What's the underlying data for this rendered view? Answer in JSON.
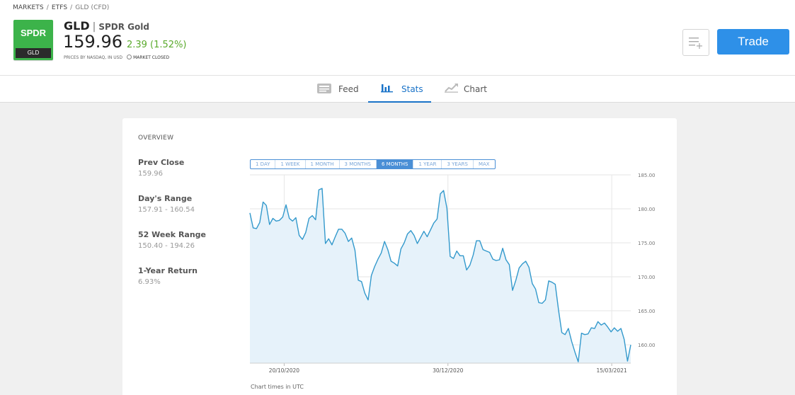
{
  "breadcrumb": {
    "items": [
      "MARKETS",
      "ETFS"
    ],
    "current": "GLD (CFD)"
  },
  "logo": {
    "top": "SPDR",
    "bottom": "GLD"
  },
  "instrument": {
    "symbol": "GLD",
    "name": "SPDR Gold",
    "price": "159.96",
    "change": "2.39 (1.52%)",
    "price_source": "PRICES BY NASDAQ, IN USD",
    "market_status": "MARKET CLOSED"
  },
  "colors": {
    "accent": "#2e90e8",
    "positive": "#5aaa2c",
    "brand_logo": "#3cb34a",
    "line": "#3399cc",
    "area": "#e6f2fa"
  },
  "icons": {
    "watchlist": "list-add-icon",
    "feed": "feed-icon",
    "stats": "bar-chart-icon",
    "chart": "line-chart-icon",
    "clock": "clock-icon"
  },
  "actions": {
    "trade_label": "Trade"
  },
  "tabs": [
    {
      "label": "Feed",
      "active": false
    },
    {
      "label": "Stats",
      "active": true
    },
    {
      "label": "Chart",
      "active": false
    }
  ],
  "overview": {
    "title": "OVERVIEW",
    "stats": [
      {
        "label": "Prev Close",
        "value": "159.96"
      },
      {
        "label": "Day's Range",
        "value": "157.91 - 160.54"
      },
      {
        "label": "52 Week Range",
        "value": "150.40 - 194.26"
      },
      {
        "label": "1-Year Return",
        "value": "6.93%"
      }
    ],
    "ranges": [
      "1 DAY",
      "1 WEEK",
      "1 MONTH",
      "3 MONTHS",
      "6 MONTHS",
      "1 YEAR",
      "3 YEARS",
      "MAX"
    ],
    "active_range": "6 MONTHS",
    "chart_note": "Chart times in UTC"
  },
  "chart_data": {
    "type": "area",
    "ylim": [
      157.3,
      185.0
    ],
    "y_ticks": [
      "185.00",
      "180.00",
      "175.00",
      "170.00",
      "165.00",
      "160.00"
    ],
    "y_tick_values": [
      185,
      180,
      175,
      170,
      165,
      160
    ],
    "x_tick_labels": [
      "20/10/2020",
      "30/12/2020",
      "15/03/2021"
    ],
    "x_tick_positions": [
      9,
      52,
      95
    ],
    "grid": true,
    "series": [
      {
        "values": [
          179.4,
          177.2,
          177.1,
          178.0,
          181.0,
          180.5,
          177.7,
          178.6,
          178.2,
          178.3,
          178.8,
          180.6,
          178.6,
          178.2,
          178.7,
          176.1,
          175.5,
          176.5,
          178.6,
          179.0,
          178.4,
          182.8,
          183.0,
          174.9,
          175.6,
          174.7,
          175.9,
          177.0,
          177.0,
          176.4,
          175.2,
          175.7,
          173.9,
          169.5,
          169.3,
          167.6,
          166.6,
          170.2,
          171.5,
          172.6,
          173.5,
          175.2,
          174.0,
          172.3,
          172.0,
          171.6,
          174.1,
          175.0,
          176.3,
          176.8,
          176.1,
          174.9,
          175.8,
          176.7,
          175.9,
          176.9,
          177.9,
          178.5,
          182.2,
          182.7,
          180.1,
          173.0,
          172.7,
          173.8,
          173.1,
          173.1,
          171.0,
          171.7,
          173.2,
          175.3,
          175.3,
          174.0,
          173.8,
          173.6,
          172.6,
          172.4,
          172.5,
          174.2,
          172.5,
          171.8,
          168.0,
          169.5,
          171.3,
          171.9,
          172.3,
          171.4,
          169.0,
          168.2,
          166.2,
          166.1,
          166.6,
          169.4,
          169.2,
          168.9,
          165.1,
          161.8,
          161.5,
          162.4,
          160.5,
          158.9,
          157.5,
          161.7,
          161.5,
          161.6,
          162.5,
          162.4,
          163.4,
          162.9,
          163.2,
          162.6,
          161.9,
          162.5,
          162.0,
          162.4,
          160.8,
          157.6,
          160.0
        ]
      }
    ]
  }
}
